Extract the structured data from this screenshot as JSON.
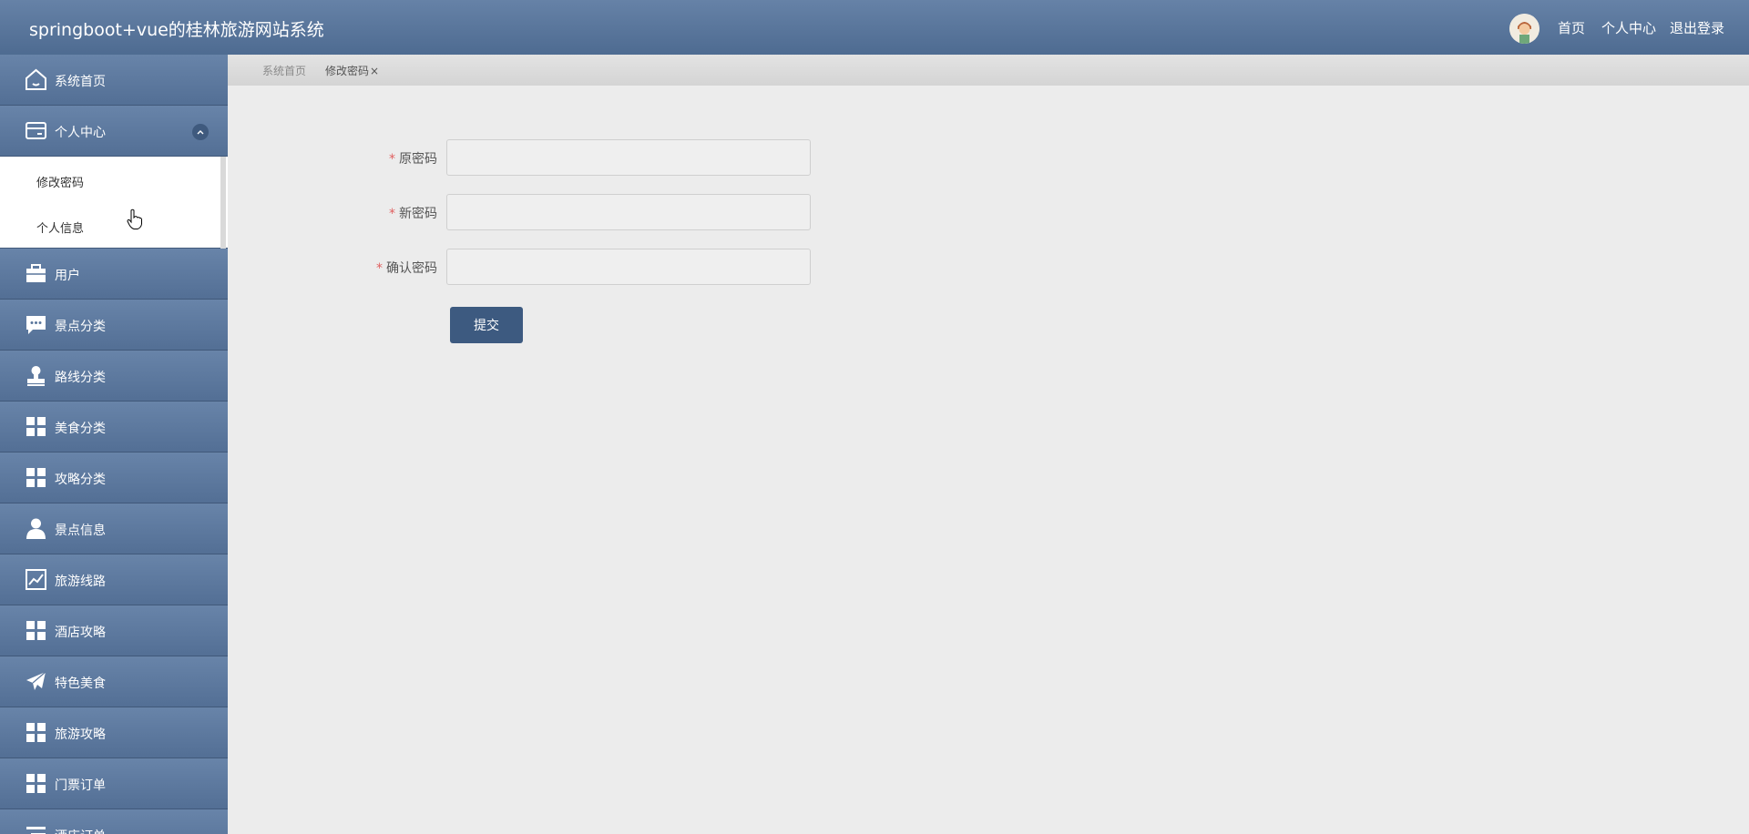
{
  "header": {
    "title": "springboot+vue的桂林旅游网站系统",
    "nav": [
      "首页",
      "个人中心",
      "退出登录"
    ]
  },
  "sidebar": {
    "items": [
      {
        "label": "系统首页",
        "icon": "home-icon"
      },
      {
        "label": "个人中心",
        "icon": "card-icon",
        "expanded": true,
        "children": [
          "修改密码",
          "个人信息"
        ]
      },
      {
        "label": "用户",
        "icon": "briefcase-icon"
      },
      {
        "label": "景点分类",
        "icon": "chat-icon"
      },
      {
        "label": "路线分类",
        "icon": "stamp-icon"
      },
      {
        "label": "美食分类",
        "icon": "grid-icon"
      },
      {
        "label": "攻略分类",
        "icon": "grid-icon"
      },
      {
        "label": "景点信息",
        "icon": "user-icon"
      },
      {
        "label": "旅游线路",
        "icon": "chart-icon"
      },
      {
        "label": "酒店攻略",
        "icon": "grid-icon"
      },
      {
        "label": "特色美食",
        "icon": "paper-plane-icon"
      },
      {
        "label": "旅游攻略",
        "icon": "grid-icon"
      },
      {
        "label": "门票订单",
        "icon": "grid-icon"
      },
      {
        "label": "酒店订单",
        "icon": "list-icon"
      }
    ]
  },
  "breadcrumb": {
    "items": [
      "系统首页",
      "修改密码"
    ],
    "close": "×"
  },
  "form": {
    "required_mark": "*",
    "fields": [
      {
        "label": "原密码",
        "value": ""
      },
      {
        "label": "新密码",
        "value": ""
      },
      {
        "label": "确认密码",
        "value": ""
      }
    ],
    "submit_label": "提交"
  },
  "colors": {
    "header": "#5a769c",
    "sidebar": "#5a769c",
    "button": "#3d5a80",
    "background": "#ececec"
  }
}
